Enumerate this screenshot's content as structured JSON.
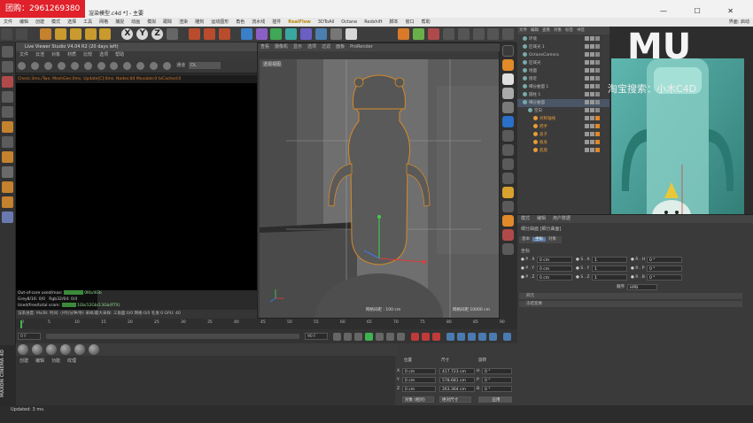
{
  "promo": {
    "label": "团购：",
    "number": "2961269380"
  },
  "window": {
    "title": "渲染模型.c4d *] - 主要",
    "controls": "— ☐ ✕"
  },
  "menubar": {
    "items": [
      "文件",
      "编辑",
      "创建",
      "模式",
      "选择",
      "工具",
      "网格",
      "捕捉",
      "动画",
      "模拟",
      "跟踪",
      "渲染",
      "雕刻",
      "运动图形",
      "角色",
      "流水线",
      "插件",
      "RealFlow",
      "3DToAll",
      "Octane",
      "Redshift",
      "脚本",
      "窗口",
      "帮助"
    ],
    "layout_label": "界面: 启动"
  },
  "render_viewer": {
    "title": "Live Viewer Studio V4.04 R2 (20 days left)",
    "menu": [
      "文件",
      "云渲",
      "对象",
      "材质",
      "比较",
      "选项",
      "帮助"
    ],
    "mode_label": "通道",
    "mode_value": "DL",
    "status_line": "Check:3ms./Two: MeshGen:0ms. Update[C]:0ms. Nodes:84 Movable:0 txCached:0",
    "stats": [
      {
        "label": "Out-of-core used/max:",
        "value": "0Kb/4Gb"
      },
      {
        "label": "Grey8/16:",
        "value": "0/0",
        "label2": "Rgb32/64:",
        "value2": "0/4"
      },
      {
        "label": "Used/free/total vram:",
        "value": "1Gb/12Gb/13Gb(RTX)"
      }
    ],
    "bottom": "渲染进度:    Ms/Bl:    时间: 小时/分钟/秒/ 采样/最大采样:    三角面:0/0  网格:0/0  毛发:0  GPU:  40"
  },
  "viewport": {
    "tabs": [
      "查看",
      "摄像机",
      "显示",
      "选项",
      "过滤",
      "面板",
      "ProRender"
    ],
    "menu": [
      "查看",
      "摄像机",
      "显示",
      "选项",
      "过滤",
      "面板"
    ],
    "label": "透视视图",
    "grid_label": "网格间距 : 100 cm",
    "dist_label": "网格间距 10000 cm"
  },
  "object_manager": {
    "tabs": [
      "文件",
      "编辑",
      "查看",
      "对象",
      "标签",
      "书签"
    ],
    "rows": [
      {
        "name": "环境",
        "indent": 0,
        "style": "normal"
      },
      {
        "name": "区域光 1",
        "indent": 0,
        "style": "normal"
      },
      {
        "name": "OctaneCamera",
        "indent": 0,
        "style": "normal"
      },
      {
        "name": "区域光",
        "indent": 0,
        "style": "normal"
      },
      {
        "name": "地面",
        "indent": 0,
        "style": "normal"
      },
      {
        "name": "接近",
        "indent": 0,
        "style": "normal"
      },
      {
        "name": "细分曲面 1",
        "indent": 0,
        "style": "normal"
      },
      {
        "name": "圆柱 1",
        "indent": 0,
        "style": "normal"
      },
      {
        "name": "细分曲面",
        "indent": 0,
        "style": "sel"
      },
      {
        "name": "空白",
        "indent": 1,
        "style": "normal"
      },
      {
        "name": "对称轴线",
        "indent": 2,
        "style": "orange"
      },
      {
        "name": "把手",
        "indent": 2,
        "style": "orange"
      },
      {
        "name": "盖子",
        "indent": 2,
        "style": "orange"
      },
      {
        "name": "瓶身",
        "indent": 2,
        "style": "orange"
      },
      {
        "name": "底座",
        "indent": 2,
        "style": "orange"
      }
    ]
  },
  "watermark": {
    "logo": "MU",
    "text": "淘宝搜索：小木C4D"
  },
  "attributes": {
    "tabs": [
      "模式",
      "编辑",
      "用户数据"
    ],
    "object_name": "细分曲面 [细分曲面]",
    "modes": [
      "基本",
      "坐标",
      "对象"
    ],
    "section": "坐标",
    "fields": {
      "px": "0 cm",
      "py": "0 cm",
      "pz": "0 cm",
      "sx": "1",
      "sy": "1",
      "sz": "1",
      "rh": "0 °",
      "rp": "0 °",
      "rb": "0 °",
      "order_label": "顺序",
      "order": "HPB"
    },
    "extra_sections": [
      "四元",
      "冻结变换"
    ]
  },
  "timeline": {
    "ticks": [
      "0",
      "5",
      "10",
      "15",
      "20",
      "25",
      "30",
      "35",
      "40",
      "45",
      "50",
      "55",
      "60",
      "65",
      "70",
      "75",
      "80",
      "85",
      "90"
    ],
    "current_frame": "0 F",
    "end_frame": "90 F",
    "frame_badge": "0 F"
  },
  "materials": {
    "menu": [
      "创建",
      "编辑",
      "功能",
      "纹理"
    ],
    "count": 6
  },
  "coordinates": {
    "headers": [
      "位置",
      "尺寸",
      "旋转"
    ],
    "rows": [
      {
        "axis": "X",
        "pos": "0 cm",
        "size": "417.723 cm",
        "rot_label": "H",
        "rot": "0 °"
      },
      {
        "axis": "Y",
        "pos": "0 cm",
        "size": "578.681 cm",
        "rot_label": "P",
        "rot": "0 °"
      },
      {
        "axis": "Z",
        "pos": "0 cm",
        "size": "263.364 cm",
        "rot_label": "B",
        "rot": "0 °"
      }
    ],
    "mode_btn": "对象 (相对)",
    "size_btn": "绝对尺寸",
    "apply_btn": "应用"
  },
  "logo": "MAXON CINEMA 4D",
  "status": "Updated: 3 ms."
}
